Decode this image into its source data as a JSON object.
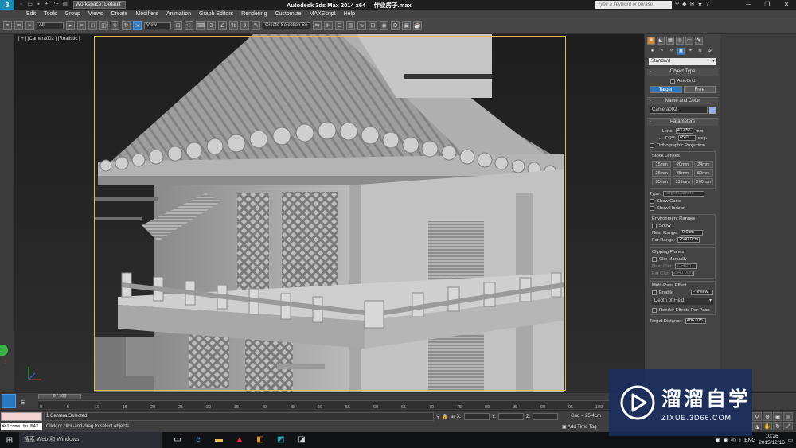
{
  "title_bar": {
    "app_logo": "3ds-max-logo",
    "workspace": "Workspace: Default",
    "app_title": "Autodesk 3ds Max  2014 x64",
    "file_name": "作业房子.max",
    "search_placeholder": "Type a keyword or phrase",
    "window_buttons": [
      "─",
      "❐",
      "✕"
    ]
  },
  "menu": [
    "Edit",
    "Tools",
    "Group",
    "Views",
    "Create",
    "Modifiers",
    "Animation",
    "Graph Editors",
    "Rendering",
    "Customize",
    "MAXScript",
    "Help"
  ],
  "toolbar": {
    "selection_filter": "All",
    "ref_coord": "View",
    "named_selection": "Create Selection Se"
  },
  "viewport": {
    "label": "[ + ] [Camera002 ] [Realistic ]"
  },
  "command_panel": {
    "category_dropdown": "Standard",
    "object_type": {
      "title": "Object Type",
      "autogrid": "AutoGrid",
      "buttons": [
        "Target",
        "Free"
      ],
      "active": "Target"
    },
    "name_and_color": {
      "title": "Name and Color",
      "name": "Camera002",
      "color": "#8fb0ff"
    },
    "parameters": {
      "title": "Parameters",
      "lens_label": "Lens:",
      "lens_value": "43.456",
      "lens_unit": "mm",
      "fov_label": "FOV:",
      "fov_value": "45.0",
      "fov_unit": "deg.",
      "ortho": "Orthographic Projection",
      "stock_lenses_title": "Stock Lenses",
      "stock_lenses": [
        "15mm",
        "20mm",
        "24mm",
        "28mm",
        "35mm",
        "50mm",
        "85mm",
        "135mm",
        "200mm"
      ],
      "type_label": "Type:",
      "type_value": "Target Camera",
      "show_cone": "Show Cone",
      "show_horizon": "Show Horizon",
      "env_title": "Environment Ranges",
      "env_show": "Show",
      "near_range_label": "Near Range:",
      "near_range": "0.0cm",
      "far_range_label": "Far Range:",
      "far_range": "2540.0cm",
      "clip_title": "Clipping Planes",
      "clip_manually": "Clip Manually",
      "near_clip_label": "Near Clip:",
      "near_clip": "2.54cm",
      "far_clip_label": "Far Clip:",
      "far_clip": "2540.0cm",
      "multipass_title": "Multi-Pass Effect",
      "enable": "Enable",
      "preview": "Preview",
      "effect": "Depth of Field",
      "render_per_pass": "Render Effects Per Pass",
      "target_distance_label": "Target Distance:",
      "target_distance": "486.015"
    }
  },
  "timeline": {
    "frame": "0 / 100",
    "ticks": [
      "0",
      "5",
      "10",
      "15",
      "20",
      "25",
      "30",
      "35",
      "40",
      "45",
      "50",
      "55",
      "60",
      "65",
      "70",
      "75",
      "80",
      "85",
      "90",
      "95",
      "100"
    ]
  },
  "status": {
    "welcome": "Welcome to MAX",
    "selection": "1 Camera Selected",
    "prompt": "Click or click-and-drag to select objects",
    "x_label": "X:",
    "y_label": "Y:",
    "z_label": "Z:",
    "grid": "Grid = 25.4cm",
    "add_time_tag": "Add Time Tag"
  },
  "taskbar": {
    "search": "搜索 Web 和 Windows",
    "ime": "ENG",
    "time": "10:26",
    "date": "2015/12/16"
  },
  "watermark": {
    "name": "溜溜自学",
    "url": "ZIXUE.3D66.COM"
  }
}
